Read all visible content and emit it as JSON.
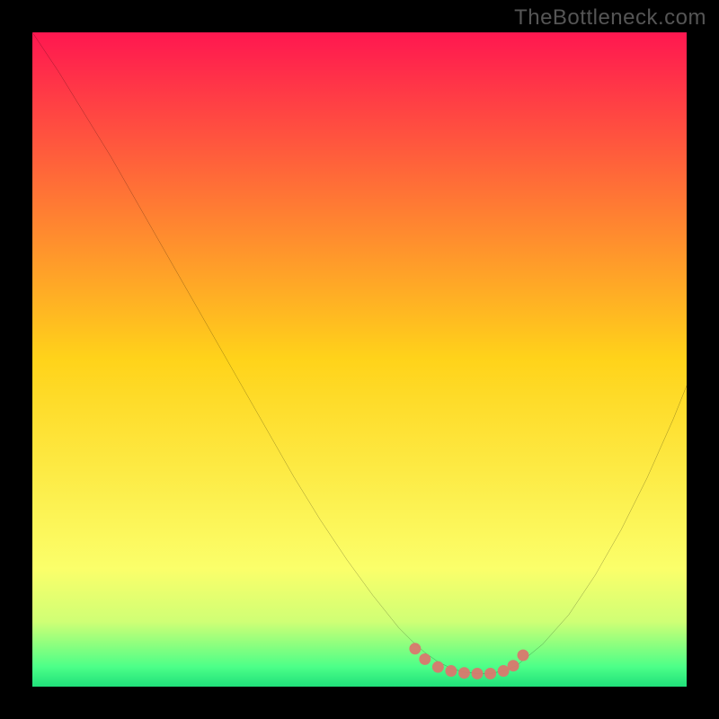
{
  "watermark": "TheBottleneck.com",
  "chart_data": {
    "type": "line",
    "title": "",
    "xlabel": "",
    "ylabel": "",
    "xlim": [
      0,
      100
    ],
    "ylim": [
      0,
      100
    ],
    "legend": false,
    "grid": false,
    "background_gradient": {
      "stops": [
        {
          "offset": 0.0,
          "color": "#ff1750"
        },
        {
          "offset": 0.5,
          "color": "#ffd31a"
        },
        {
          "offset": 0.82,
          "color": "#fbff6a"
        },
        {
          "offset": 0.9,
          "color": "#d0ff75"
        },
        {
          "offset": 0.97,
          "color": "#4cff88"
        },
        {
          "offset": 1.0,
          "color": "#20e07a"
        }
      ]
    },
    "series": [
      {
        "name": "bottleneck-curve",
        "color": "#000000",
        "width": 1.4,
        "x": [
          0,
          4,
          8,
          12,
          16,
          20,
          24,
          28,
          32,
          36,
          40,
          44,
          48,
          52,
          56,
          58,
          60,
          62,
          64,
          66,
          68,
          70,
          72,
          74,
          78,
          82,
          86,
          90,
          94,
          98,
          100
        ],
        "y": [
          100,
          94,
          87.5,
          81,
          74,
          67,
          60,
          53,
          46,
          39,
          32,
          25.5,
          19.5,
          14,
          9,
          7,
          5.2,
          3.8,
          2.8,
          2.2,
          2.0,
          2.0,
          2.4,
          3.2,
          6.5,
          11,
          17,
          24,
          32,
          41,
          46
        ]
      }
    ],
    "highlight": {
      "name": "valley-marker",
      "color": "#d9786e",
      "points": [
        {
          "x": 58.5,
          "y": 5.8
        },
        {
          "x": 60.0,
          "y": 4.2
        },
        {
          "x": 62.0,
          "y": 3.0
        },
        {
          "x": 64.0,
          "y": 2.4
        },
        {
          "x": 66.0,
          "y": 2.1
        },
        {
          "x": 68.0,
          "y": 2.0
        },
        {
          "x": 70.0,
          "y": 2.0
        },
        {
          "x": 72.0,
          "y": 2.4
        },
        {
          "x": 73.5,
          "y": 3.2
        },
        {
          "x": 75.0,
          "y": 4.8
        }
      ],
      "radius": 6.5
    }
  }
}
